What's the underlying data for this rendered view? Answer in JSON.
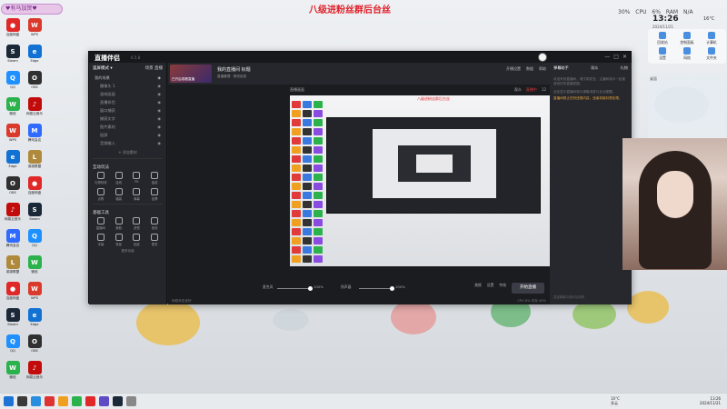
{
  "desktop": {
    "banner": "八级进粉丝群后台丝",
    "user_badge": "♥有马加贺♥",
    "icons": [
      {
        "label": "百度网盘",
        "color": "#e02828",
        "glyph": "●"
      },
      {
        "label": "Steam",
        "color": "#1b2838",
        "glyph": "S"
      },
      {
        "label": "QQ",
        "color": "#1e90ff",
        "glyph": "Q"
      },
      {
        "label": "微信",
        "color": "#2bb24c",
        "glyph": "W"
      },
      {
        "label": "WPS",
        "color": "#d93a2b",
        "glyph": "W"
      },
      {
        "label": "Edge",
        "color": "#1172d4",
        "glyph": "e"
      },
      {
        "label": "OBS",
        "color": "#303030",
        "glyph": "O"
      },
      {
        "label": "网易云音乐",
        "color": "#c20c0c",
        "glyph": "♪"
      },
      {
        "label": "腾讯会议",
        "color": "#2f6bff",
        "glyph": "M"
      },
      {
        "label": "英雄联盟",
        "color": "#b08a3c",
        "glyph": "L"
      }
    ]
  },
  "system": {
    "stats": [
      "CPU",
      "6%",
      "RAM",
      "N/A"
    ],
    "cpu_label": "30%",
    "clock": "13:26",
    "temp": "16°C",
    "date": "2024/11/21",
    "tools": [
      "回收站",
      "控制面板",
      "计算机",
      "设置",
      "网络",
      "文件夹"
    ],
    "side_panel_title": "桌面"
  },
  "app": {
    "logo": "直播伴侣",
    "version": "6.5.8",
    "titlebar_buttons": [
      "—",
      "□",
      "✕"
    ],
    "left": {
      "mode_label": "竖屏模式 ▾",
      "tabs": [
        "场景",
        "直播"
      ],
      "scenes": [
        {
          "label": "我的场景",
          "sub": false
        },
        {
          "label": "摄像头 1",
          "sub": true
        },
        {
          "label": "游戏画面",
          "sub": true
        },
        {
          "label": "直播伴侣",
          "sub": true
        },
        {
          "label": "窗口捕获",
          "sub": true
        },
        {
          "label": "捕获文字",
          "sub": true
        },
        {
          "label": "图片素材",
          "sub": true
        },
        {
          "label": "投屏",
          "sub": true
        },
        {
          "label": "音频输入",
          "sub": true
        }
      ],
      "add_scene": "+ 添加素材",
      "interactive_title": "互动玩法",
      "interactive_tools": [
        "礼物特效",
        "连线",
        "PK",
        "抽奖",
        "点歌",
        "福袋",
        "弹幕",
        "投票"
      ],
      "basic_title": "基础工具",
      "basic_tools": [
        "直播间",
        "美颜",
        "滤镜",
        "音效",
        "字幕",
        "背景",
        "贴纸",
        "更多"
      ],
      "more_link": "更多功能"
    },
    "center": {
      "live_thumb_caption": "已开启观看直播",
      "live_title": "我的直播间 标题",
      "live_sub": "直播管理 · 修改信息",
      "top_right": [
        "开播设置",
        "数据",
        "帮助"
      ],
      "row2_left": "直播画面",
      "row2_right_prefix": "观众",
      "row2_right_live": "直播中",
      "row2_right_count": "12",
      "preview_banner": "八级进粉丝群后台丝",
      "mic_label": "麦克风",
      "mic_value": "100%",
      "speaker_label": "扬声器",
      "speaker_value": "100%",
      "controls": [
        "美颜",
        "设置",
        "特效"
      ],
      "start_button": "开始直播",
      "status_left": "网络状态良好",
      "status_right": "CPU 6%  内存 40%"
    },
    "right": {
      "tabs": [
        "弹幕助手",
        "观众",
        "礼物"
      ],
      "text1": "欢迎来到直播间，请文明发言，主播和观众一起营造良好的直播氛围。",
      "notice": "直播间禁止任何违规内容，违者将被封禁处理。",
      "text2": "此处显示直播间观众弹幕消息与互动提醒。",
      "footer": "发送弹幕与观众互动吧"
    }
  },
  "taskbar": {
    "weather_temp": "16°C",
    "weather_desc": "多云",
    "time": "13:26",
    "date": "2024/11/21",
    "app_colors": [
      "#1e73d6",
      "#3a3a3a",
      "#2a8ee0",
      "#d33",
      "#f0a020",
      "#2bb24c",
      "#e02828",
      "#5f4cc4",
      "#1b2838",
      "#888"
    ]
  }
}
